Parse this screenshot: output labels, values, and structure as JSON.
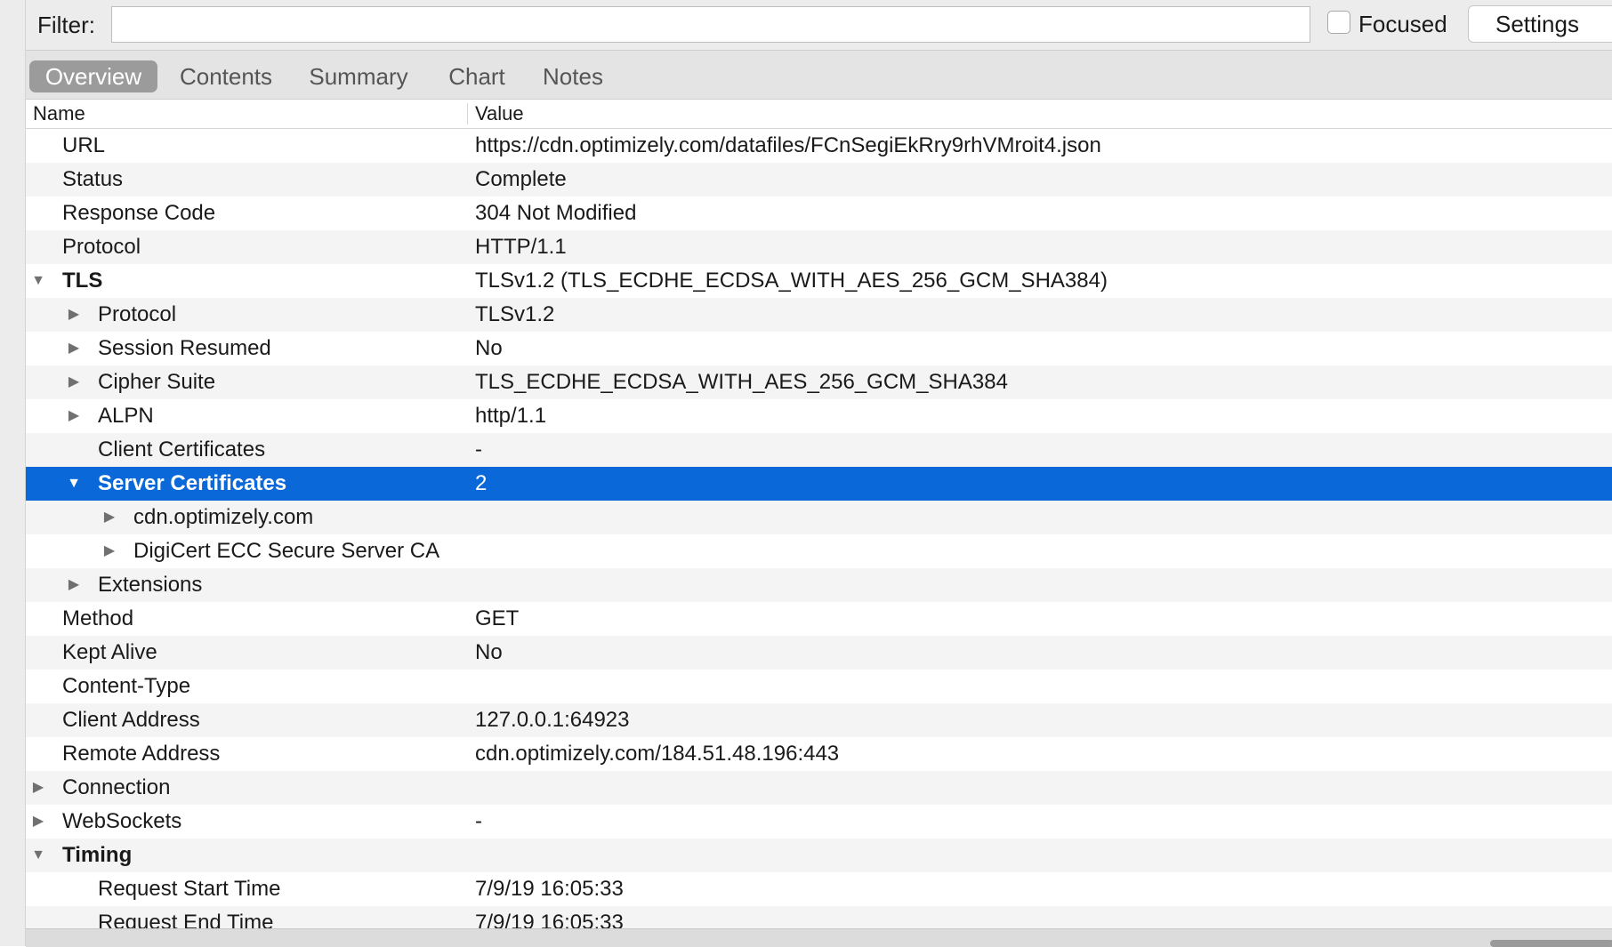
{
  "filter": {
    "label": "Filter:",
    "value": "",
    "placeholder": ""
  },
  "focused": {
    "label": "Focused",
    "checked": false
  },
  "settings_label": "Settings",
  "tabs": [
    {
      "label": "Overview",
      "active": true
    },
    {
      "label": "Contents",
      "active": false
    },
    {
      "label": "Summary",
      "active": false
    },
    {
      "label": "Chart",
      "active": false
    },
    {
      "label": "Notes",
      "active": false
    }
  ],
  "columns": {
    "name": "Name",
    "value": "Value"
  },
  "rows": [
    {
      "name": "URL",
      "value": "https://cdn.optimizely.com/datafiles/FCnSegiEkRry9rhVMroit4.json"
    },
    {
      "name": "Status",
      "value": "Complete"
    },
    {
      "name": "Response Code",
      "value": "304 Not Modified"
    },
    {
      "name": "Protocol",
      "value": "HTTP/1.1"
    },
    {
      "name": "TLS",
      "value": "TLSv1.2 (TLS_ECDHE_ECDSA_WITH_AES_256_GCM_SHA384)",
      "expander": "expanded"
    },
    {
      "name": "Protocol",
      "value": "TLSv1.2",
      "expander": "collapsed"
    },
    {
      "name": "Session Resumed",
      "value": "No",
      "expander": "collapsed"
    },
    {
      "name": "Cipher Suite",
      "value": "TLS_ECDHE_ECDSA_WITH_AES_256_GCM_SHA384",
      "expander": "collapsed"
    },
    {
      "name": "ALPN",
      "value": "http/1.1",
      "expander": "collapsed"
    },
    {
      "name": "Client Certificates",
      "value": "-"
    },
    {
      "name": "Server Certificates",
      "value": "2",
      "expander": "expanded",
      "selected": true
    },
    {
      "name": "cdn.optimizely.com",
      "value": "",
      "expander": "collapsed"
    },
    {
      "name": "DigiCert ECC Secure Server CA",
      "value": "",
      "expander": "collapsed"
    },
    {
      "name": "Extensions",
      "value": "",
      "expander": "collapsed"
    },
    {
      "name": "Method",
      "value": "GET"
    },
    {
      "name": "Kept Alive",
      "value": "No"
    },
    {
      "name": "Content-Type",
      "value": ""
    },
    {
      "name": "Client Address",
      "value": "127.0.0.1:64923"
    },
    {
      "name": "Remote Address",
      "value": "cdn.optimizely.com/184.51.48.196:443"
    },
    {
      "name": "Connection",
      "value": "",
      "expander": "collapsed"
    },
    {
      "name": "WebSockets",
      "value": "-",
      "expander": "collapsed"
    },
    {
      "name": "Timing",
      "value": "",
      "expander": "expanded"
    },
    {
      "name": "Request Start Time",
      "value": "7/9/19 16:05:33"
    },
    {
      "name": "Request End Time",
      "value": "7/9/19 16:05:33"
    }
  ],
  "colors": {
    "selection": "#0a68d8",
    "active_tab": "#9b9b9b"
  },
  "icons": {
    "expanded": "triangle-down-icon",
    "collapsed": "triangle-right-icon"
  }
}
